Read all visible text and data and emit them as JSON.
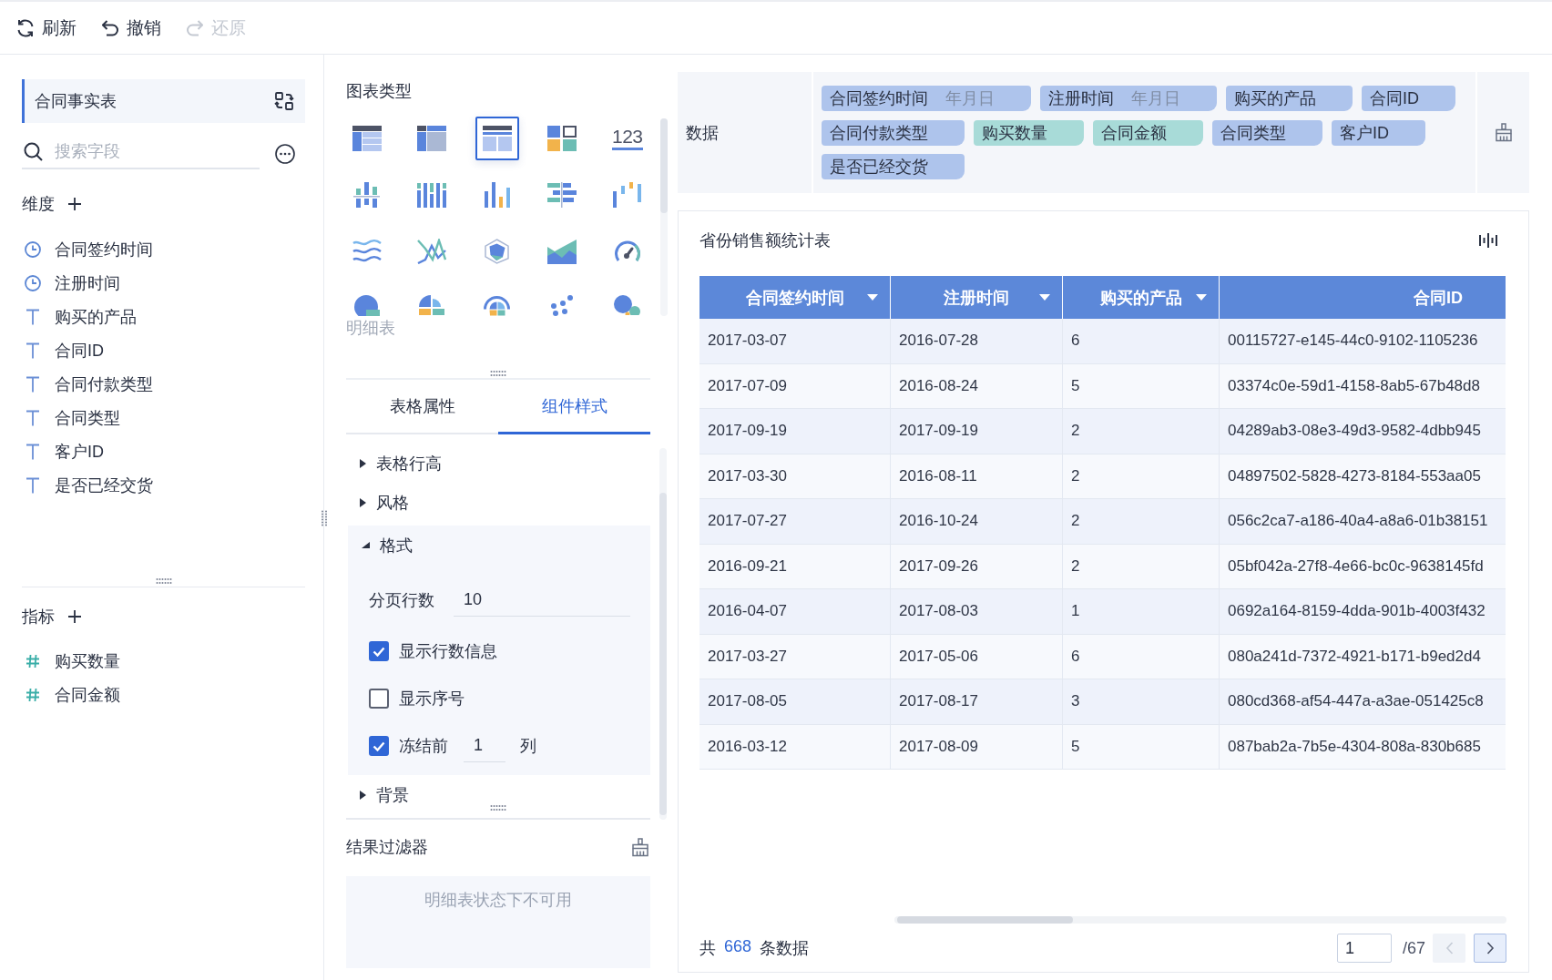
{
  "toolbar": {
    "buttons": [
      {
        "kind": "refresh",
        "label": "刷新",
        "disabled": false
      },
      {
        "kind": "undo",
        "label": "撤销",
        "disabled": false
      },
      {
        "kind": "redo",
        "label": "还原",
        "disabled": true
      }
    ]
  },
  "sidebar": {
    "dataset": {
      "title": "合同事实表"
    },
    "search": {
      "placeholder": "搜索字段"
    },
    "dimensions": {
      "title": "维度",
      "fields": [
        {
          "kind": "date",
          "name": "合同签约时间"
        },
        {
          "kind": "date",
          "name": "注册时间"
        },
        {
          "kind": "text",
          "name": "购买的产品"
        },
        {
          "kind": "text",
          "name": "合同ID"
        },
        {
          "kind": "text",
          "name": "合同付款类型"
        },
        {
          "kind": "text",
          "name": "合同类型"
        },
        {
          "kind": "text",
          "name": "客户ID"
        },
        {
          "kind": "text",
          "name": "是否已经交货"
        }
      ]
    },
    "measures": {
      "title": "指标",
      "fields": [
        {
          "kind": "number",
          "name": "购买数量"
        },
        {
          "kind": "number",
          "name": "合同金额"
        }
      ]
    }
  },
  "chart_types": {
    "title": "图表类型",
    "items": [
      {
        "kind": "group-table",
        "selected": false
      },
      {
        "kind": "cross-table",
        "selected": false
      },
      {
        "kind": "detail-table",
        "selected": true
      },
      {
        "kind": "dashboard",
        "selected": false
      },
      {
        "kind": "kpi",
        "label": "123",
        "selected": false
      },
      {
        "kind": "grouped-column",
        "selected": false
      },
      {
        "kind": "stacked-column",
        "selected": false
      },
      {
        "kind": "column",
        "selected": false
      },
      {
        "kind": "bar",
        "selected": false
      },
      {
        "kind": "waterfall",
        "selected": false
      },
      {
        "kind": "multi-line",
        "selected": false
      },
      {
        "kind": "line",
        "selected": false
      },
      {
        "kind": "radar",
        "selected": false
      },
      {
        "kind": "area",
        "selected": false
      },
      {
        "kind": "gauge",
        "selected": false
      },
      {
        "kind": "pie",
        "selected": false
      },
      {
        "kind": "rose",
        "selected": false
      },
      {
        "kind": "sunburst",
        "selected": false
      },
      {
        "kind": "scatter",
        "selected": false
      },
      {
        "kind": "bubble",
        "selected": false
      }
    ],
    "caption": "明细表"
  },
  "property_tabs": [
    {
      "label": "表格属性",
      "selected": false
    },
    {
      "label": "组件样式",
      "selected": true
    }
  ],
  "style_sections": [
    {
      "title": "表格行高",
      "expanded": false
    },
    {
      "title": "风格",
      "expanded": false
    },
    {
      "title": "格式",
      "expanded": true,
      "settings": [
        {
          "kind": "number",
          "label": "分页行数",
          "value": "10"
        },
        {
          "kind": "checkbox",
          "label": "显示行数信息",
          "checked": true
        },
        {
          "kind": "checkbox",
          "label": "显示序号",
          "checked": false
        },
        {
          "kind": "freeze",
          "label": "冻结前",
          "checked": true,
          "value": "1",
          "suffix": "列"
        }
      ]
    },
    {
      "title": "背景",
      "expanded": false
    }
  ],
  "result_filter": {
    "title": "结果过滤器",
    "message": "明细表状态下不可用"
  },
  "data_bar": {
    "label": "数据",
    "chips": [
      {
        "kind": "dimension",
        "name": "合同签约时间",
        "suffix": "年月日"
      },
      {
        "kind": "dimension",
        "name": "注册时间",
        "suffix": "年月日"
      },
      {
        "kind": "dimension",
        "name": "购买的产品"
      },
      {
        "kind": "dimension",
        "name": "合同ID"
      },
      {
        "kind": "dimension",
        "name": "合同付款类型"
      },
      {
        "kind": "measure",
        "name": "购买数量"
      },
      {
        "kind": "measure",
        "name": "合同金额"
      },
      {
        "kind": "dimension",
        "name": "合同类型"
      },
      {
        "kind": "dimension",
        "name": "客户ID"
      },
      {
        "kind": "dimension",
        "name": "是否已经交货"
      }
    ]
  },
  "table_card": {
    "title": "省份销售额统计表",
    "columns": [
      {
        "label": "合同签约时间",
        "sortable": true
      },
      {
        "label": "注册时间",
        "sortable": true
      },
      {
        "label": "购买的产品",
        "sortable": true
      },
      {
        "label": "合同ID",
        "sortable": false
      }
    ],
    "rows": [
      [
        "2017-03-07",
        "2016-07-28",
        "6",
        "00115727-e145-44c0-9102-1105236"
      ],
      [
        "2017-07-09",
        "2016-08-24",
        "5",
        "03374c0e-59d1-4158-8ab5-67b48d8"
      ],
      [
        "2017-09-19",
        "2017-09-19",
        "2",
        "04289ab3-08e3-49d3-9582-4dbb945"
      ],
      [
        "2017-03-30",
        "2016-08-11",
        "2",
        "04897502-5828-4273-8184-553aa05"
      ],
      [
        "2017-07-27",
        "2016-10-24",
        "2",
        "056c2ca7-a186-40a4-a8a6-01b38151"
      ],
      [
        "2016-09-21",
        "2017-09-26",
        "2",
        "05bf042a-27f8-4e66-bc0c-9638145fd"
      ],
      [
        "2016-04-07",
        "2017-08-03",
        "1",
        "0692a164-8159-4dda-901b-4003f432"
      ],
      [
        "2017-03-27",
        "2017-05-06",
        "6",
        "080a241d-7372-4921-b171-b9ed2d4"
      ],
      [
        "2017-08-05",
        "2017-08-17",
        "3",
        "080cd368-af54-447a-a3ae-051425c8"
      ],
      [
        "2016-03-12",
        "2017-08-09",
        "5",
        "087bab2a-7b5e-4304-808a-830b685"
      ]
    ],
    "total": {
      "before": "共",
      "count": "668",
      "after": "条数据"
    },
    "pagination": {
      "page": "1",
      "pages": "/67",
      "prev_disabled": true,
      "next_disabled": false
    }
  }
}
